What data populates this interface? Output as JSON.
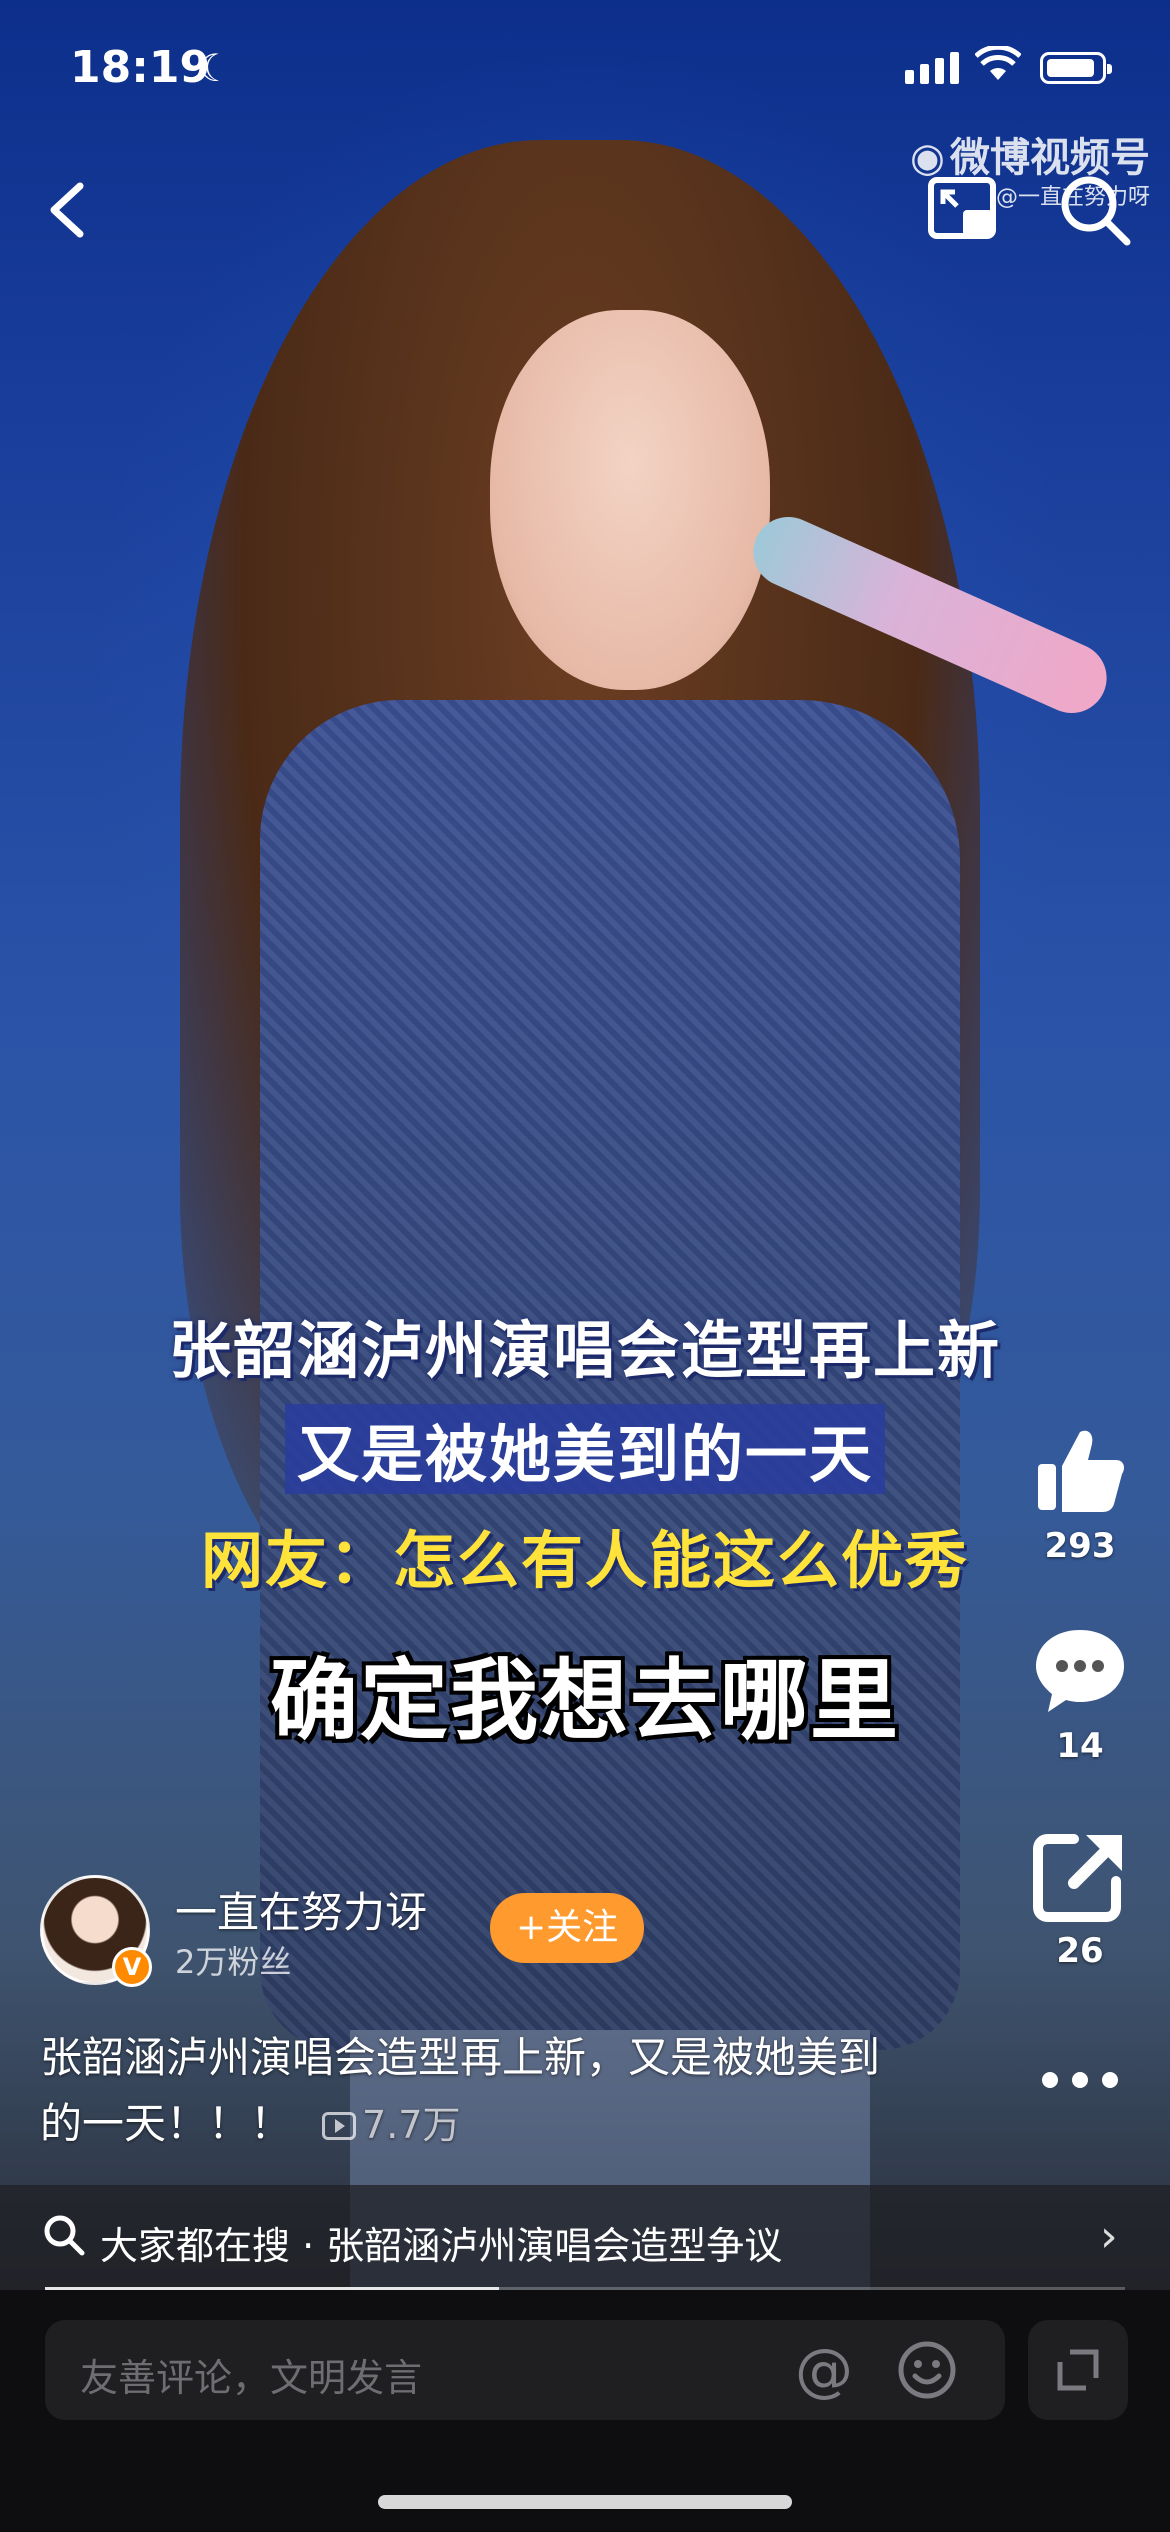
{
  "status_bar": {
    "time": "18:19",
    "moon_icon": "moon-icon",
    "signal_icon": "cellular-signal-icon",
    "wifi_icon": "wifi-icon",
    "battery_icon": "battery-icon",
    "battery_level": 0.9
  },
  "top_bar": {
    "back_icon": "chevron-left-icon",
    "watermark_title": "微博视频号",
    "watermark_sub": "@一直在努力呀",
    "pip_icon": "picture-in-picture-icon",
    "search_icon": "search-icon"
  },
  "captions": {
    "line1": "张韶涵泸州演唱会造型再上新",
    "line2": "又是被她美到的一天",
    "line3": "网友：怎么有人能这么优秀",
    "line4": "确定我想去哪里"
  },
  "actions": {
    "like_count": "293",
    "comment_count": "14",
    "share_count": "26",
    "like_icon": "thumbs-up-icon",
    "comment_icon": "comment-bubble-icon",
    "share_icon": "share-icon",
    "more_icon": "more-dots-icon"
  },
  "author": {
    "name": "一直在努力讶",
    "fans": "2万粉丝",
    "verified_badge": "V",
    "follow_label": "+关注"
  },
  "post": {
    "text": "张韶涵泸州演唱会造型再上新，又是被她美到的一天！！！",
    "views": "7.7万"
  },
  "search_suggestion": {
    "text": "大家都在搜 · 张韶涵泸州演唱会造型争议",
    "progress": 0.42
  },
  "comment_bar": {
    "placeholder": "友善评论，文明发言",
    "at_symbol": "@",
    "emoji_icon": "smiley-face-icon",
    "expand_icon": "expand-icon"
  },
  "colors": {
    "follow_button": "#ff9a2e",
    "caption_highlight": "#ffe23a",
    "verified_badge": "#ff8a00"
  }
}
